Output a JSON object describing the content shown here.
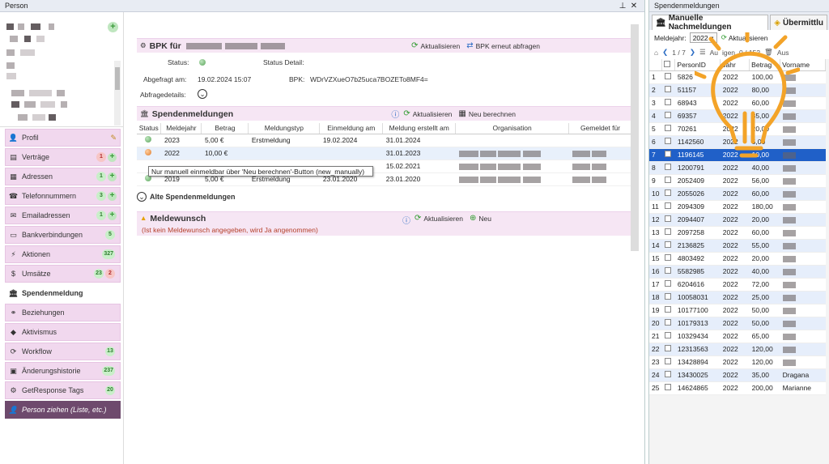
{
  "left_window": {
    "title": "Person"
  },
  "person_info": {
    "add_label": "+"
  },
  "nav": [
    {
      "label": "Profil",
      "icon": "person-icon",
      "badge": "",
      "badge_red": "",
      "plus": false,
      "edit": true
    },
    {
      "label": "Verträge",
      "icon": "contract-icon",
      "badge": "1",
      "badge_red": "",
      "plus": true,
      "edit": false,
      "badge_color": "red"
    },
    {
      "label": "Adressen",
      "icon": "address-icon",
      "badge": "1",
      "badge_red": "",
      "plus": true,
      "edit": false
    },
    {
      "label": "Telefonnummern",
      "icon": "phone-icon",
      "badge": "3",
      "badge_red": "",
      "plus": true,
      "edit": false
    },
    {
      "label": "Emailadressen",
      "icon": "email-icon",
      "badge": "1",
      "badge_red": "",
      "plus": true,
      "edit": false
    },
    {
      "label": "Bankverbindungen",
      "icon": "bank-icon",
      "badge": "5",
      "badge_red": "",
      "plus": false,
      "edit": false
    },
    {
      "label": "Aktionen",
      "icon": "lightning-icon",
      "badge": "327",
      "badge_red": "",
      "plus": false,
      "edit": false
    },
    {
      "label": "Umsätze",
      "icon": "money-icon",
      "badge": "23",
      "badge_red": "2",
      "plus": false,
      "edit": false
    },
    {
      "label": "Spendenmeldung",
      "icon": "building-icon",
      "badge": "",
      "badge_red": "",
      "plus": false,
      "edit": false,
      "active": true
    },
    {
      "label": "Beziehungen",
      "icon": "relations-icon",
      "badge": "",
      "badge_red": "",
      "plus": false,
      "edit": false
    },
    {
      "label": "Aktivismus",
      "icon": "activism-icon",
      "badge": "",
      "badge_red": "",
      "plus": false,
      "edit": false
    },
    {
      "label": "Workflow",
      "icon": "workflow-icon",
      "badge": "13",
      "badge_red": "",
      "plus": false,
      "edit": false
    },
    {
      "label": "Änderungshistorie",
      "icon": "history-icon",
      "badge": "237",
      "badge_red": "",
      "plus": false,
      "edit": false
    },
    {
      "label": "GetResponse Tags",
      "icon": "tag-icon",
      "badge": "20",
      "badge_red": "",
      "plus": false,
      "edit": false
    },
    {
      "label": "Person ziehen (Liste, etc.)",
      "icon": "drag-person-icon",
      "badge": "",
      "badge_red": "",
      "plus": false,
      "edit": false,
      "dark": true
    }
  ],
  "bpk": {
    "title": "BPK für",
    "refresh": "Aktualisieren",
    "requery": "BPK erneut abfragen",
    "status_label": "Status:",
    "status_detail_label": "Status Detail:",
    "queried_label": "Abgefragt am:",
    "queried_value": "19.02.2024 15:07",
    "bpk_label": "BPK:",
    "bpk_value": "WDrVZXueO7b25uca7BOZETo8MF4=",
    "details_label": "Abfragedetails:"
  },
  "donations": {
    "title": "Spendenmeldungen",
    "refresh": "Aktualisieren",
    "recalc": "Neu berechnen",
    "columns": [
      "Status",
      "Meldejahr",
      "Betrag",
      "Meldungstyp",
      "Einmeldung am",
      "Meldung erstellt am",
      "Organisation",
      "Gemeldet für"
    ],
    "rows": [
      {
        "year": "2023",
        "amount": "5,00 €",
        "type": "Erstmeldung",
        "reported": "19.02.2024",
        "created": "31.01.2024",
        "status": "green"
      },
      {
        "year": "2022",
        "amount": "10,00 €",
        "type": "",
        "reported": "",
        "created": "31.01.2023",
        "status": "orange"
      },
      {
        "year": "",
        "amount": "",
        "type": "",
        "reported": "",
        "created": "15.02.2021",
        "status": ""
      },
      {
        "year": "2019",
        "amount": "5,00 €",
        "type": "Erstmeldung",
        "reported": "23.01.2020",
        "created": "23.01.2020",
        "status": "green"
      }
    ],
    "tooltip": "Nur manuell einmeldbar über 'Neu berechnen'-Button (new_manually)",
    "old_label": "Alte Spendenmeldungen"
  },
  "wish": {
    "title": "Meldewunsch",
    "refresh": "Aktualisieren",
    "new": "Neu",
    "note": "(Ist kein Meldewunsch angegeben, wird Ja angenommen)"
  },
  "right": {
    "title": "Spendenmeldungen",
    "tab1": "Manuelle Nachmeldungen",
    "tab2": "Übermittlu",
    "year_label": "Meldejahr:",
    "year_value": "2022",
    "refresh": "Aktualisieren",
    "page": "1 / 7",
    "count": "0 / 152",
    "partial1": "Au",
    "partial2": "igen",
    "partial3": "Aus",
    "columns": [
      "",
      "",
      "PersonID",
      "Jahr",
      "Betrag",
      "Vorname"
    ],
    "rows": [
      {
        "n": "1",
        "id": "5826",
        "year": "2022",
        "amount": "100,00",
        "name": ""
      },
      {
        "n": "2",
        "id": "51157",
        "year": "2022",
        "amount": "80,00",
        "name": ""
      },
      {
        "n": "3",
        "id": "68943",
        "year": "2022",
        "amount": "60,00",
        "name": ""
      },
      {
        "n": "4",
        "id": "69357",
        "year": "2022",
        "amount": "35,00",
        "name": ""
      },
      {
        "n": "5",
        "id": "70261",
        "year": "2022",
        "amount": "20,00",
        "name": ""
      },
      {
        "n": "6",
        "id": "1142560",
        "year": "2022",
        "amount": "5,00",
        "name": ""
      },
      {
        "n": "7",
        "id": "1196145",
        "year": "2022",
        "amount": "10,00",
        "name": "",
        "sel": true
      },
      {
        "n": "8",
        "id": "1200791",
        "year": "2022",
        "amount": "40,00",
        "name": ""
      },
      {
        "n": "9",
        "id": "2052409",
        "year": "2022",
        "amount": "56,00",
        "name": ""
      },
      {
        "n": "10",
        "id": "2055026",
        "year": "2022",
        "amount": "60,00",
        "name": ""
      },
      {
        "n": "11",
        "id": "2094309",
        "year": "2022",
        "amount": "180,00",
        "name": ""
      },
      {
        "n": "12",
        "id": "2094407",
        "year": "2022",
        "amount": "20,00",
        "name": ""
      },
      {
        "n": "13",
        "id": "2097258",
        "year": "2022",
        "amount": "60,00",
        "name": ""
      },
      {
        "n": "14",
        "id": "2136825",
        "year": "2022",
        "amount": "55,00",
        "name": ""
      },
      {
        "n": "15",
        "id": "4803492",
        "year": "2022",
        "amount": "20,00",
        "name": ""
      },
      {
        "n": "16",
        "id": "5582985",
        "year": "2022",
        "amount": "40,00",
        "name": ""
      },
      {
        "n": "17",
        "id": "6204616",
        "year": "2022",
        "amount": "72,00",
        "name": ""
      },
      {
        "n": "18",
        "id": "10058031",
        "year": "2022",
        "amount": "25,00",
        "name": ""
      },
      {
        "n": "19",
        "id": "10177100",
        "year": "2022",
        "amount": "50,00",
        "name": ""
      },
      {
        "n": "20",
        "id": "10179313",
        "year": "2022",
        "amount": "50,00",
        "name": ""
      },
      {
        "n": "21",
        "id": "10329434",
        "year": "2022",
        "amount": "65,00",
        "name": ""
      },
      {
        "n": "22",
        "id": "12313563",
        "year": "2022",
        "amount": "120,00",
        "name": ""
      },
      {
        "n": "23",
        "id": "13428894",
        "year": "2022",
        "amount": "120,00",
        "name": ""
      },
      {
        "n": "24",
        "id": "13430025",
        "year": "2022",
        "amount": "35,00",
        "name": "Dragana"
      },
      {
        "n": "25",
        "id": "14624865",
        "year": "2022",
        "amount": "200,00",
        "name": "Marianne"
      }
    ]
  }
}
